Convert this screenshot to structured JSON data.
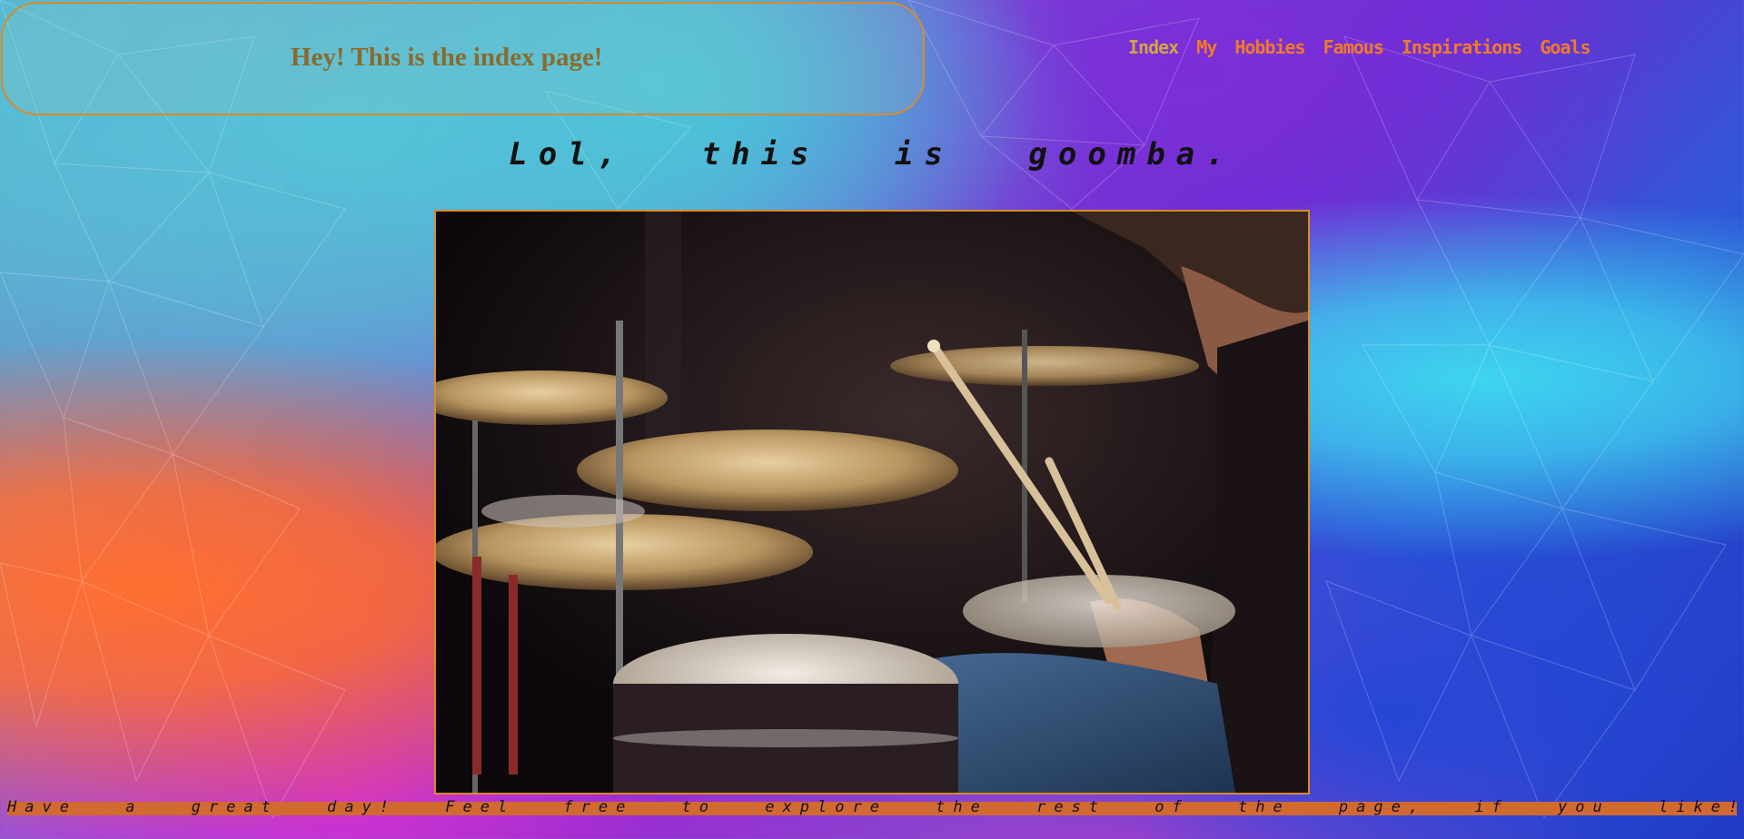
{
  "header": {
    "title": "Hey! This is the index page!"
  },
  "nav": {
    "items": [
      {
        "label": "Index"
      },
      {
        "label": "My"
      },
      {
        "label": "Hobbies"
      },
      {
        "label": "Famous"
      },
      {
        "label": "Inspirations"
      },
      {
        "label": "Goals"
      }
    ]
  },
  "main": {
    "tagline": "Lol, this is goomba.",
    "image": {
      "icon": "drummer-photo"
    }
  },
  "footer": {
    "text": "Have a great day! Feel free to explore the rest of the page, if you like!"
  },
  "colors": {
    "accent": "#d88a2c",
    "nav_text": "#f07a2a",
    "title_text": "#8a6a2e",
    "footer_bar": "#d06a30"
  }
}
